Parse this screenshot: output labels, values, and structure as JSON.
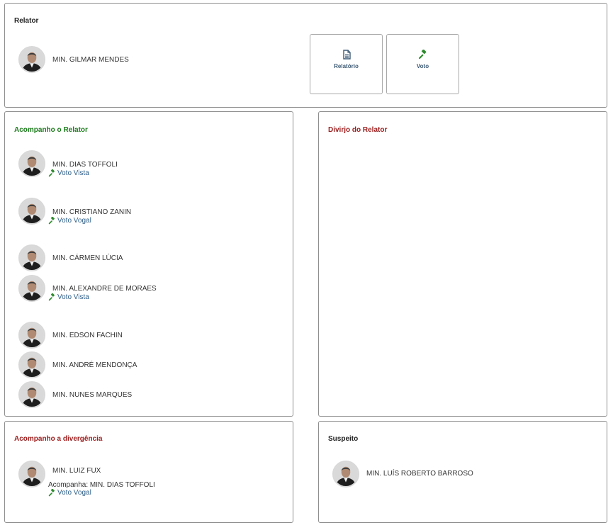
{
  "relator": {
    "title": "Relator",
    "minister": {
      "name": "MIN. GILMAR MENDES"
    },
    "buttons": [
      {
        "label": "Relatório",
        "icon": "document-icon"
      },
      {
        "label": "Voto",
        "icon": "gavel-icon"
      }
    ]
  },
  "acompanho": {
    "title": "Acompanho o Relator",
    "ministers": [
      {
        "name": "MIN. DIAS TOFFOLI",
        "vote": "Voto Vista"
      },
      {
        "name": "MIN. CRISTIANO ZANIN",
        "vote": "Voto Vogal"
      },
      {
        "name": "MIN. CÁRMEN LÚCIA"
      },
      {
        "name": "MIN. ALEXANDRE DE MORAES",
        "vote": "Voto Vista"
      },
      {
        "name": "MIN. EDSON FACHIN"
      },
      {
        "name": "MIN. ANDRÉ MENDONÇA"
      },
      {
        "name": "MIN. NUNES MARQUES"
      }
    ]
  },
  "divirjo": {
    "title": "Divirjo do Relator"
  },
  "divergencia": {
    "title": "Acompanho a divergência",
    "minister": {
      "name": "MIN. LUIZ FUX",
      "follows": "Acompanha: MIN. DIAS TOFFOLI",
      "vote": "Voto Vogal"
    }
  },
  "suspeito": {
    "title": "Suspeito",
    "minister": {
      "name": "MIN. LUÍS ROBERTO BARROSO"
    }
  },
  "colors": {
    "green": "#1c7a1c",
    "red": "#9b1c1c",
    "link": "#2e5f8a",
    "border": "#8f8f8f"
  }
}
